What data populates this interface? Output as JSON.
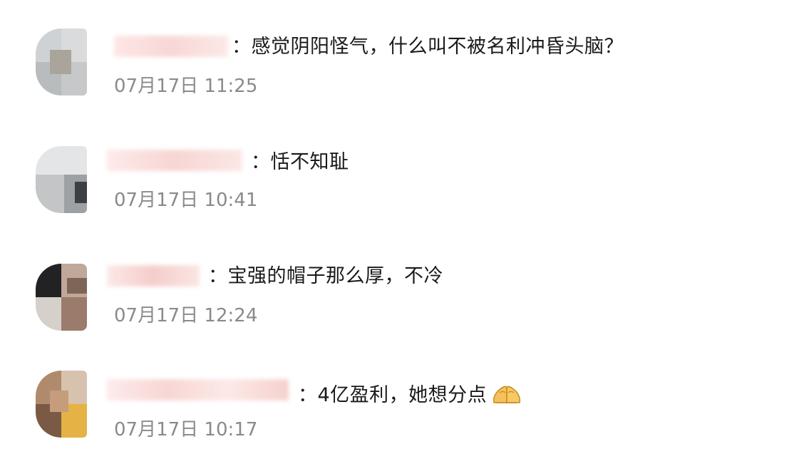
{
  "comments": [
    {
      "text": "：感觉阴阳怪气，什么叫不被名利冲昏头脑？",
      "time": "07月17日 11:25"
    },
    {
      "text": "：恬不知耻",
      "time": "07月17日 10:41"
    },
    {
      "text": "：宝强的帽子那么厚，不冷",
      "time": "07月17日 12:24"
    },
    {
      "text": "：4亿盈利，她想分点",
      "time": "07月17日 10:17",
      "emoji": "palms-up-together-icon"
    }
  ]
}
